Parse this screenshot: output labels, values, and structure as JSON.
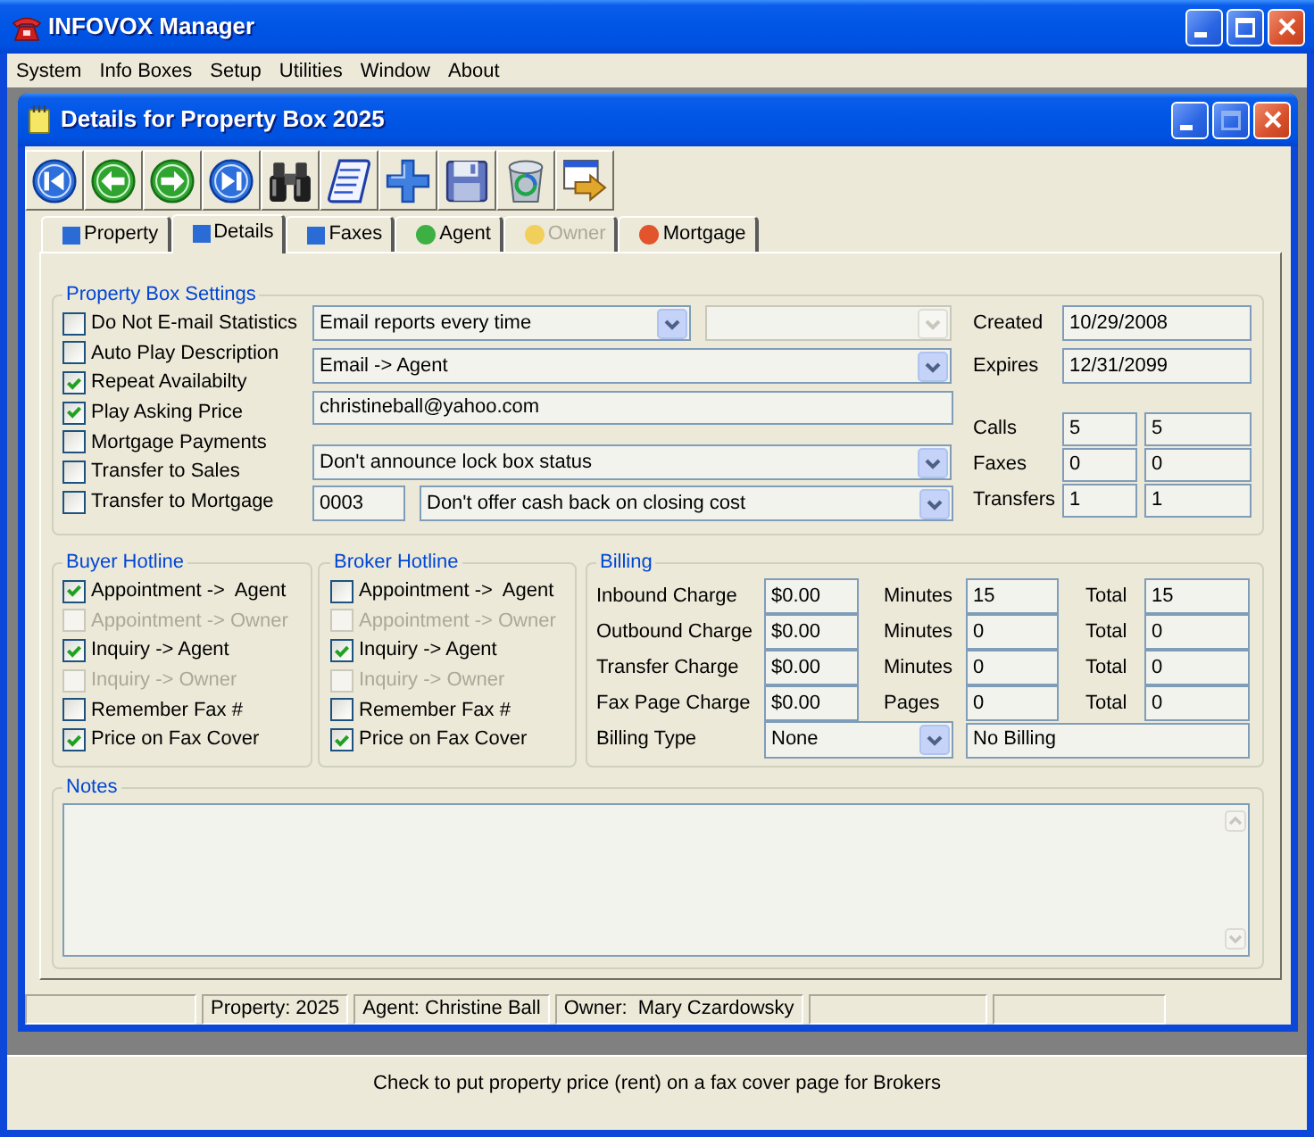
{
  "window": {
    "title": "INFOVOX Manager"
  },
  "menu": [
    "System",
    "Info Boxes",
    "Setup",
    "Utilities",
    "Window",
    "About"
  ],
  "child_window": {
    "title": "Details for Property Box 2025",
    "maximize": {
      "disabled": true
    }
  },
  "tabs": [
    {
      "label": "Property",
      "kind": "section",
      "color": "#2b6bd6",
      "selected": false,
      "disabled": false
    },
    {
      "label": "Details",
      "kind": "section",
      "color": "#2b6bd6",
      "selected": true,
      "disabled": false
    },
    {
      "label": "Faxes",
      "kind": "section",
      "color": "#2b6bd6",
      "selected": false,
      "disabled": false
    },
    {
      "label": "Agent",
      "kind": "status",
      "color": "#3cb043",
      "selected": false,
      "disabled": false
    },
    {
      "label": "Owner",
      "kind": "status",
      "color": "#f2cf5b",
      "selected": false,
      "disabled": true
    },
    {
      "label": "Mortgage",
      "kind": "status",
      "color": "#e2542c",
      "selected": false,
      "disabled": false
    }
  ],
  "property_box_settings": {
    "title": "Property Box Settings",
    "options": [
      {
        "label": "Do Not E-mail Statistics",
        "checked": false
      },
      {
        "label": "Auto Play Description",
        "checked": false
      },
      {
        "label": "Repeat Availabilty",
        "checked": true
      },
      {
        "label": "Play Asking Price",
        "checked": true
      },
      {
        "label": "Mortgage Payments",
        "checked": false
      },
      {
        "label": "Transfer to Sales",
        "checked": false
      },
      {
        "label": "Transfer to Mortgage",
        "checked": false
      }
    ],
    "report_frequency": {
      "value": "Email reports every time"
    },
    "report_option": {
      "disabled": true
    },
    "email_recipient": {
      "value": "Email -> Agent"
    },
    "email_address": {
      "value": "christineball@yahoo.com"
    },
    "lock_box": {
      "value": "Don't announce lock box status"
    },
    "cash_back_code": {
      "value": "0003"
    },
    "cash_back": {
      "value": "Don't offer cash back on closing cost"
    },
    "dates": [
      {
        "label": "Created",
        "value": "10/29/2008"
      },
      {
        "label": "Expires",
        "value": "12/31/2099"
      }
    ],
    "counters": [
      {
        "label": "Calls",
        "values": [
          "5",
          "5"
        ]
      },
      {
        "label": "Faxes",
        "values": [
          "0",
          "0"
        ]
      },
      {
        "label": "Transfers",
        "values": [
          "1",
          "1"
        ]
      }
    ]
  },
  "buyer_hotline": {
    "title": "Buyer Hotline",
    "options": [
      {
        "label": "Appointment ->  Agent",
        "checked": true,
        "disabled": false
      },
      {
        "label": "Appointment -> Owner",
        "checked": false,
        "disabled": true
      },
      {
        "label": "Inquiry -> Agent",
        "checked": true,
        "disabled": false
      },
      {
        "label": "Inquiry -> Owner",
        "checked": false,
        "disabled": true
      },
      {
        "label": "Remember Fax #",
        "checked": false,
        "disabled": false
      },
      {
        "label": "Price on Fax Cover",
        "checked": true,
        "disabled": false
      }
    ]
  },
  "broker_hotline": {
    "title": "Broker Hotline",
    "options": [
      {
        "label": "Appointment ->  Agent",
        "checked": false,
        "disabled": false
      },
      {
        "label": "Appointment -> Owner",
        "checked": false,
        "disabled": true
      },
      {
        "label": "Inquiry -> Agent",
        "checked": true,
        "disabled": false
      },
      {
        "label": "Inquiry -> Owner",
        "checked": false,
        "disabled": true
      },
      {
        "label": "Remember Fax #",
        "checked": false,
        "disabled": false
      },
      {
        "label": "Price on Fax Cover",
        "checked": true,
        "disabled": false
      }
    ]
  },
  "billing": {
    "title": "Billing",
    "rows": [
      {
        "label": "Inbound Charge",
        "charge": "$0.00",
        "unit_label": "Minutes",
        "units": "15",
        "total_label": "Total",
        "total": "15"
      },
      {
        "label": "Outbound Charge",
        "charge": "$0.00",
        "unit_label": "Minutes",
        "units": "0",
        "total_label": "Total",
        "total": "0"
      },
      {
        "label": "Transfer Charge",
        "charge": "$0.00",
        "unit_label": "Minutes",
        "units": "0",
        "total_label": "Total",
        "total": "0"
      },
      {
        "label": "Fax Page Charge",
        "charge": "$0.00",
        "unit_label": "Pages",
        "units": "0",
        "total_label": "Total",
        "total": "0"
      }
    ],
    "billing_type": {
      "label": "Billing Type",
      "value": "None",
      "description": "No Billing"
    }
  },
  "notes": {
    "title": "Notes"
  },
  "child_status_bar": [
    "Property: 2025",
    "Agent: Christine Ball",
    "Owner:  Mary Czardowsky"
  ],
  "status_bar": {
    "text": "Check to put property price (rent) on a fax cover page for Brokers"
  }
}
